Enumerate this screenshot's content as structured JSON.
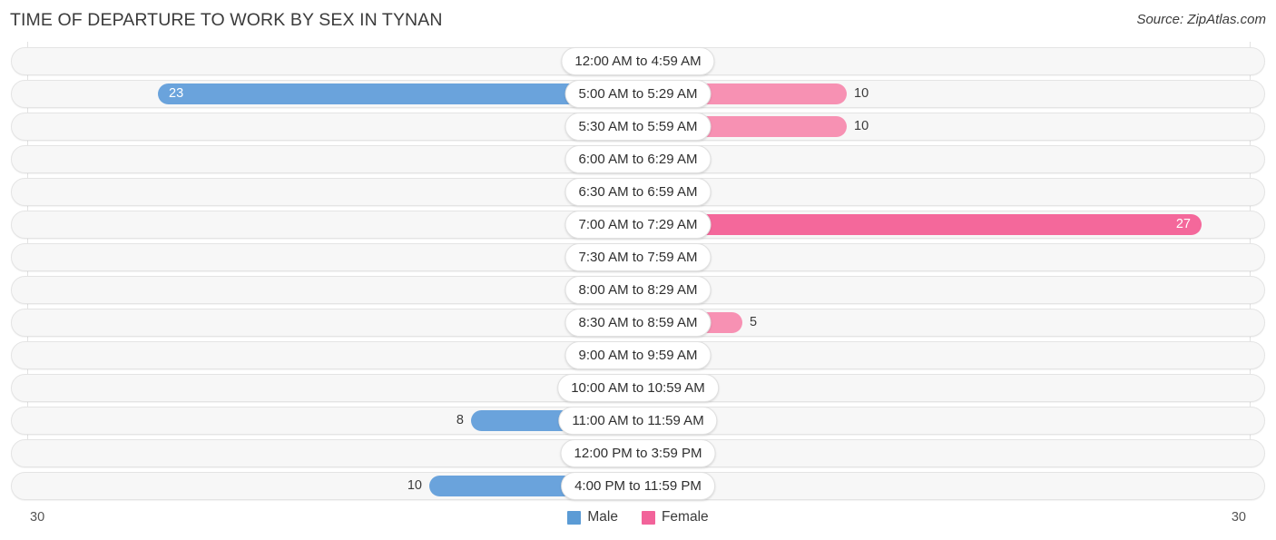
{
  "header": {
    "title": "TIME OF DEPARTURE TO WORK BY SEX IN TYNAN",
    "source": "Source: ZipAtlas.com"
  },
  "axis": {
    "left_max_label": "30",
    "right_max_label": "30"
  },
  "legend": {
    "items": [
      {
        "label": "Male",
        "color": "#5b9bd5",
        "icon": "square-swatch-icon"
      },
      {
        "label": "Female",
        "color": "#f2639a",
        "icon": "square-swatch-icon"
      }
    ]
  },
  "colors": {
    "male_strong": "#6aa3dc",
    "male_light": "#a8c8ec",
    "female_strong": "#f4689b",
    "female_mid": "#f791b3",
    "female_light": "#f9aec8",
    "track_bg": "#f7f7f7",
    "track_border": "#e4e4e4",
    "gridline": "#e2e2e2",
    "text": "#3b3b3b"
  },
  "chart_data": {
    "type": "bar",
    "subtype": "diverging-horizontal-bar",
    "title": "TIME OF DEPARTURE TO WORK BY SEX IN TYNAN",
    "xlabel": "",
    "ylabel": "",
    "xlim": [
      30,
      30
    ],
    "axis_max": 30,
    "grid": true,
    "legend_position": "bottom-center",
    "categories": [
      "12:00 AM to 4:59 AM",
      "5:00 AM to 5:29 AM",
      "5:30 AM to 5:59 AM",
      "6:00 AM to 6:29 AM",
      "6:30 AM to 6:59 AM",
      "7:00 AM to 7:29 AM",
      "7:30 AM to 7:59 AM",
      "8:00 AM to 8:29 AM",
      "8:30 AM to 8:59 AM",
      "9:00 AM to 9:59 AM",
      "10:00 AM to 10:59 AM",
      "11:00 AM to 11:59 AM",
      "12:00 PM to 3:59 PM",
      "4:00 PM to 11:59 PM"
    ],
    "series": [
      {
        "name": "Male",
        "side": "left",
        "color": "#6aa3dc",
        "values": [
          0,
          23,
          0,
          0,
          0,
          0,
          0,
          0,
          0,
          0,
          0,
          8,
          0,
          10
        ]
      },
      {
        "name": "Female",
        "side": "right",
        "color": "#f4689b",
        "values": [
          0,
          10,
          10,
          0,
          0,
          27,
          0,
          0,
          5,
          0,
          0,
          0,
          0,
          0
        ]
      }
    ]
  }
}
